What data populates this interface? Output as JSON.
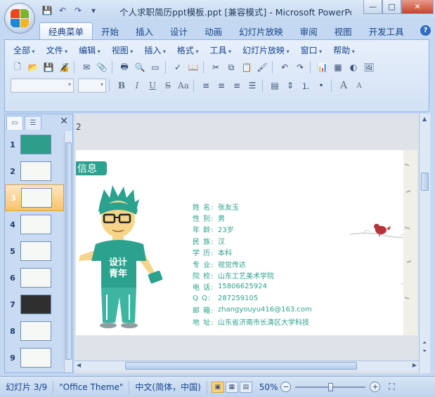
{
  "window": {
    "title": "个人求职简历ppt模板.ppt [兼容模式] - Microsoft PowerPoint",
    "controls": {
      "minimize": "—",
      "maximize": "□",
      "close": "✕"
    }
  },
  "ribbon_tabs": [
    {
      "label": "经典菜单",
      "active": true
    },
    {
      "label": "开始"
    },
    {
      "label": "插入"
    },
    {
      "label": "设计"
    },
    {
      "label": "动画"
    },
    {
      "label": "幻灯片放映"
    },
    {
      "label": "审阅"
    },
    {
      "label": "视图"
    },
    {
      "label": "开发工具"
    }
  ],
  "help_label": "?",
  "classic_menu": [
    "全部",
    "文件",
    "编辑",
    "视图",
    "插入",
    "格式",
    "工具",
    "幻灯片放映",
    "窗口",
    "帮助"
  ],
  "format_buttons": {
    "bold": "B",
    "italic": "I",
    "underline": "U",
    "strike": "S",
    "case": "Aa",
    "font_grow": "A",
    "font_shrink": "A"
  },
  "slide_panel": {
    "slides": [
      {
        "num": "1",
        "style": "teal"
      },
      {
        "num": "2",
        "style": "light"
      },
      {
        "num": "3",
        "style": "light",
        "selected": true
      },
      {
        "num": "4",
        "style": "light"
      },
      {
        "num": "5",
        "style": "light"
      },
      {
        "num": "6",
        "style": "light"
      },
      {
        "num": "7",
        "style": "dark"
      },
      {
        "num": "8",
        "style": "light"
      },
      {
        "num": "9",
        "style": "light"
      }
    ]
  },
  "slide": {
    "page_label": "2",
    "section_tag": "信息",
    "tshirt_line1": "设计",
    "tshirt_line2": "青年",
    "info_rows": [
      {
        "label": "姓 名:",
        "value": "张友玉"
      },
      {
        "label": "性 别:",
        "value": "男"
      },
      {
        "label": "年 龄:",
        "value": "23岁"
      },
      {
        "label": "民 族:",
        "value": "汉"
      },
      {
        "label": "学 历:",
        "value": "本科"
      },
      {
        "label": "专 业:",
        "value": "视觉传达"
      },
      {
        "label": "院 校:",
        "value": "山东工艺美术学院"
      },
      {
        "label": "电 话:",
        "value": "15806625924"
      },
      {
        "label": "Q Q:",
        "value": "287259105"
      },
      {
        "label": "邮 箱:",
        "value": "zhangyouyu416@163.com"
      },
      {
        "label": "地 址:",
        "value": "山东省济南市长清区大学科技"
      }
    ]
  },
  "status": {
    "slide_counter": "幻灯片 3/9",
    "theme": "\"Office Theme\"",
    "language": "中文(简体，中国)",
    "zoom": "50%",
    "zoom_fraction": 0.5
  },
  "colors": {
    "accent_teal": "#2ba28e",
    "ribbon_blue": "#15428b"
  }
}
